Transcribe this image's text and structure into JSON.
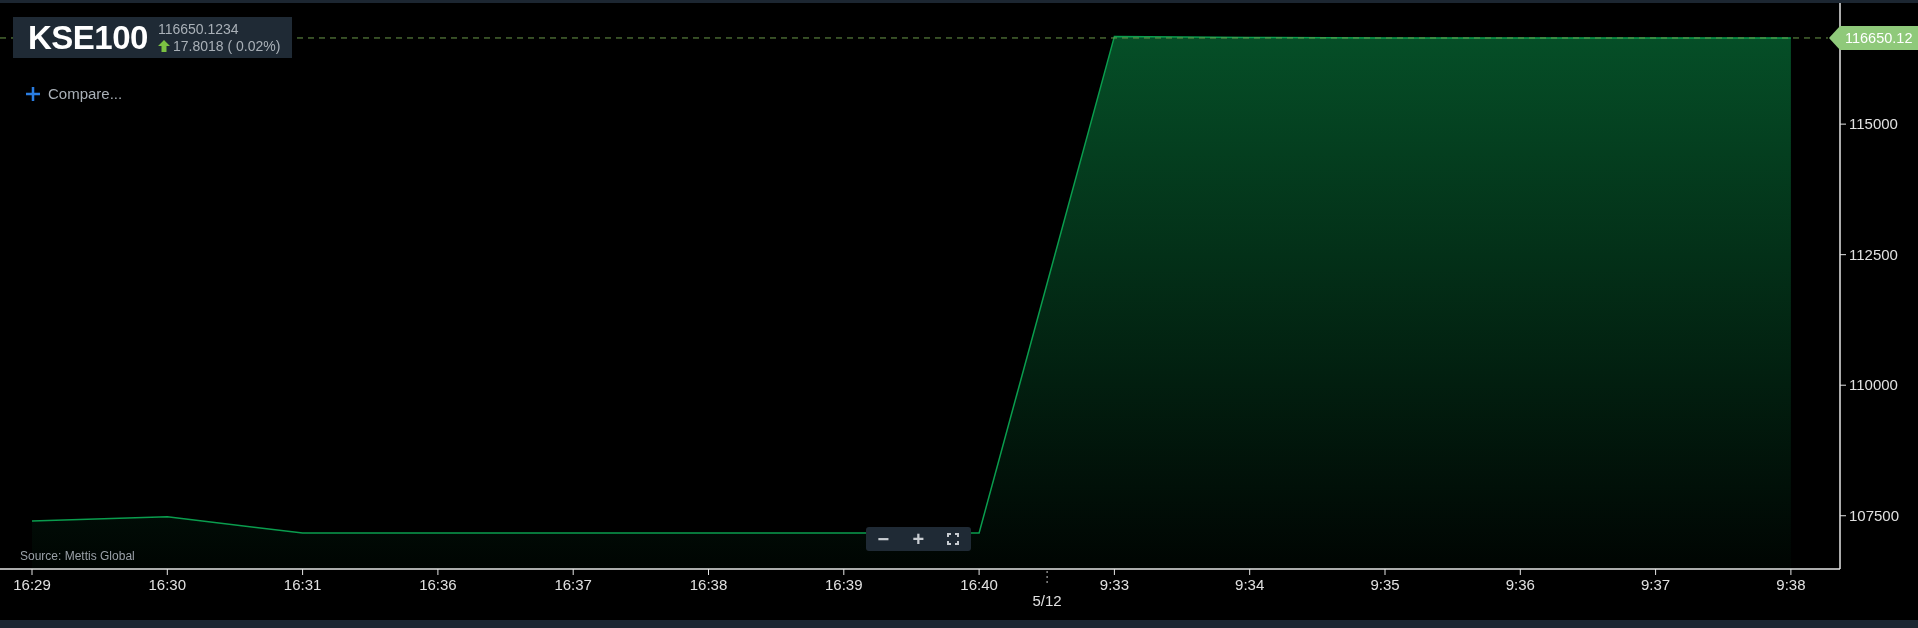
{
  "header": {
    "price": "116650.1234",
    "change": "17.8018 ( 0.02%)",
    "up": true
  },
  "compare": {
    "label": "Compare..."
  },
  "source": "Source: Mettis Global",
  "zoom_controls": [
    {
      "kind": "minus",
      "label": "−"
    },
    {
      "kind": "plus",
      "label": "+"
    },
    {
      "kind": "fullscreen"
    }
  ],
  "chart": {
    "chart_data": {
      "type": "area",
      "categories": [
        "16:29",
        "16:30",
        "16:31",
        "16:36",
        "16:37",
        "16:38",
        "16:39",
        "16:40",
        "9:33",
        "9:34",
        "9:35",
        "9:36",
        "9:37",
        "9:38"
      ],
      "series": [
        {
          "name": "KSE100",
          "color": "#0a9d4e",
          "values": [
            107400,
            107480,
            107170,
            107170,
            107170,
            107170,
            107170,
            107170,
            116680,
            116660,
            116650,
            116650,
            116650,
            116650
          ]
        }
      ],
      "ylim": [
        106480,
        117320
      ],
      "yticks": [
        107500,
        110000,
        112500,
        115000
      ],
      "ref_lines": [
        {
          "axis": "y",
          "value": 116650.12,
          "label": "116650.12",
          "color": "#6b9a4a"
        }
      ],
      "annotations": [
        "5/12"
      ]
    }
  }
}
